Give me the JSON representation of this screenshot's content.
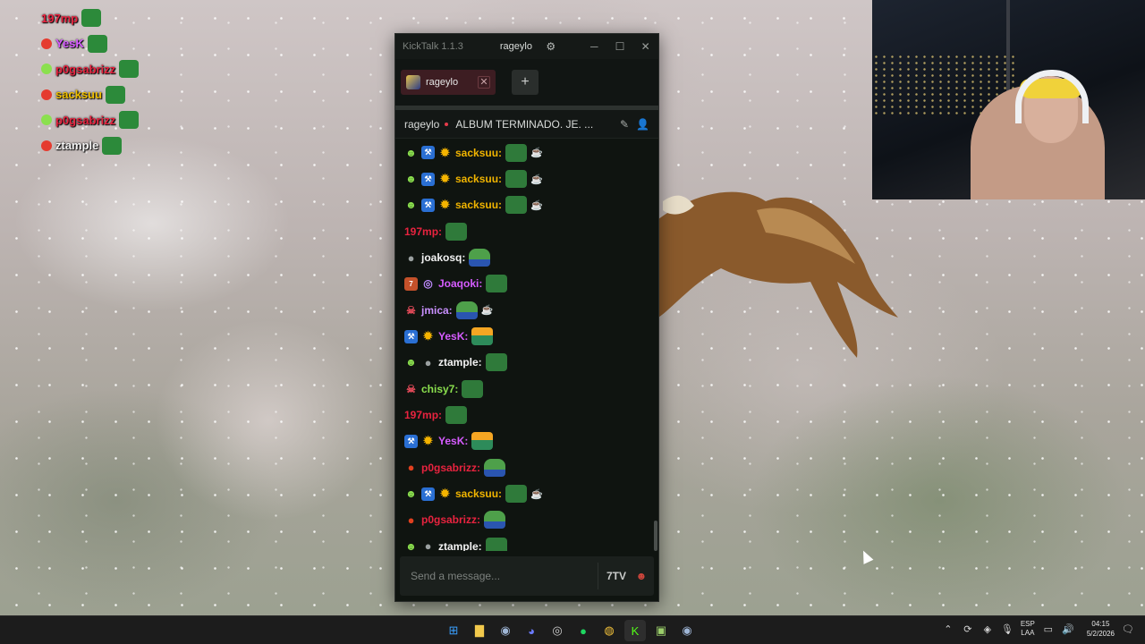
{
  "overlay": {
    "lines": [
      {
        "user": "197mp",
        "color": "#e8233f"
      },
      {
        "user": "YesK",
        "color": "#d65cff"
      },
      {
        "user": "p0gsabrizz",
        "color": "#e8233f"
      },
      {
        "user": "sacksuu",
        "color": "#f0c000"
      },
      {
        "user": "p0gsabrizz",
        "color": "#e8233f"
      },
      {
        "user": "ztample",
        "color": "#f3f3f3"
      }
    ]
  },
  "window": {
    "app_title": "KickTalk 1.1.3",
    "user": "rageylo",
    "gear_icon": "⚙",
    "minimize": "─",
    "maximize": "☐",
    "close": "✕"
  },
  "tabs": {
    "items": [
      {
        "label": "rageylo",
        "close": "✕"
      }
    ],
    "add": "+"
  },
  "header": {
    "channel": "rageylo",
    "stream_title": "ALBUM TERMINADO. JE. ...",
    "icons": [
      "pencil-icon",
      "user-icon"
    ]
  },
  "messages": [
    {
      "user": "sacksuu:",
      "color": "#f0b400",
      "badges": [
        "sub",
        "hammer",
        "gift"
      ],
      "emotes": [
        "frog",
        "extra"
      ]
    },
    {
      "user": "sacksuu:",
      "color": "#f0b400",
      "badges": [
        "sub",
        "hammer",
        "gift"
      ],
      "emotes": [
        "frog",
        "extra"
      ]
    },
    {
      "user": "sacksuu:",
      "color": "#f0b400",
      "badges": [
        "sub",
        "hammer",
        "gift"
      ],
      "emotes": [
        "frog",
        "extra"
      ]
    },
    {
      "user": "197mp:",
      "color": "#e8233f",
      "badges": [],
      "emotes": [
        "frog"
      ]
    },
    {
      "user": "joakosq:",
      "color": "#f3f3f3",
      "badges": [
        "grey"
      ],
      "emotes": [
        "face"
      ]
    },
    {
      "user": "Joaqoki:",
      "color": "#d65cff",
      "badges": [
        "og",
        "ring"
      ],
      "emotes": [
        "frog"
      ]
    },
    {
      "user": "jmica:",
      "color": "#c990ff",
      "badges": [
        "mask"
      ],
      "emotes": [
        "face",
        "extra"
      ]
    },
    {
      "user": "YesK:",
      "color": "#d65cff",
      "badges": [
        "hammer",
        "gift"
      ],
      "emotes": [
        "sunset"
      ]
    },
    {
      "user": "ztample:",
      "color": "#f3f3f3",
      "badges": [
        "sub",
        "grey"
      ],
      "emotes": [
        "frog"
      ]
    },
    {
      "user": "chisy7:",
      "color": "#8be04e",
      "badges": [
        "mask"
      ],
      "emotes": [
        "frog"
      ]
    },
    {
      "user": "197mp:",
      "color": "#e8233f",
      "badges": [],
      "emotes": [
        "frog"
      ]
    },
    {
      "user": "YesK:",
      "color": "#d65cff",
      "badges": [
        "hammer",
        "gift"
      ],
      "emotes": [
        "sunset"
      ]
    },
    {
      "user": "p0gsabrizz:",
      "color": "#e8233f",
      "badges": [
        "red"
      ],
      "emotes": [
        "face"
      ]
    },
    {
      "user": "sacksuu:",
      "color": "#f0b400",
      "badges": [
        "sub",
        "hammer",
        "gift"
      ],
      "emotes": [
        "frog",
        "extra"
      ]
    },
    {
      "user": "p0gsabrizz:",
      "color": "#e8233f",
      "badges": [
        "red"
      ],
      "emotes": [
        "face"
      ]
    },
    {
      "user": "ztample:",
      "color": "#f3f3f3",
      "badges": [
        "sub",
        "grey"
      ],
      "emotes": [
        "frog"
      ]
    }
  ],
  "input": {
    "placeholder": "Send a message...",
    "buttons": [
      "7tv-emote-icon",
      "kick-emote-icon"
    ]
  },
  "taskbar": {
    "apps": [
      "start",
      "files",
      "steam",
      "discord",
      "obs",
      "spotify",
      "chrome",
      "kick",
      "kicktalk",
      "steam2"
    ],
    "lang_top": "ESP",
    "lang_bottom": "LAA",
    "time": "04:15",
    "date": "5/2/2026"
  }
}
